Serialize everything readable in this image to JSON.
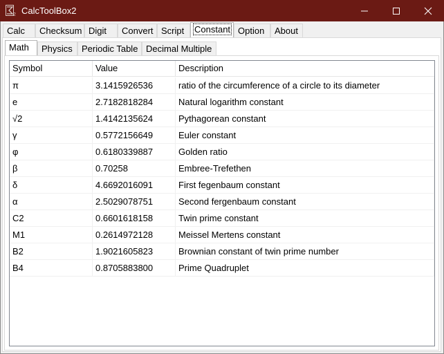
{
  "window": {
    "title": "CalcToolBox2",
    "icon": "calc-app-icon"
  },
  "window_controls": [
    "minimize-icon",
    "maximize-icon",
    "close-icon"
  ],
  "main_tabs": [
    {
      "label": "Calc"
    },
    {
      "label": "Checksum"
    },
    {
      "label": "Digit"
    },
    {
      "label": "Convert"
    },
    {
      "label": "Script"
    },
    {
      "label": "Constant",
      "selected": true
    },
    {
      "label": "Option"
    },
    {
      "label": "About"
    }
  ],
  "sub_tabs": [
    {
      "label": "Math",
      "selected": true
    },
    {
      "label": "Physics"
    },
    {
      "label": "Periodic Table"
    },
    {
      "label": "Decimal Multiple"
    }
  ],
  "table": {
    "columns": [
      "Symbol",
      "Value",
      "Description"
    ],
    "rows": [
      [
        "π",
        "3.1415926536",
        "ratio of the circumference of a circle to its diameter"
      ],
      [
        "e",
        "2.7182818284",
        "Natural logarithm constant"
      ],
      [
        "√2",
        "1.4142135624",
        "Pythagorean constant"
      ],
      [
        "γ",
        "0.5772156649",
        "Euler constant"
      ],
      [
        "φ",
        "0.6180339887",
        "Golden ratio"
      ],
      [
        "β",
        "0.70258",
        "Embree-Trefethen"
      ],
      [
        "δ",
        "4.6692016091",
        "First fegenbaum constant"
      ],
      [
        "α",
        "2.5029078751",
        "Second fergenbaum constant"
      ],
      [
        "C2",
        "0.6601618158",
        "Twin prime constant"
      ],
      [
        "M1",
        "0.2614972128",
        "Meissel Mertens constant"
      ],
      [
        "B2",
        "1.9021605823",
        "Brownian constant of twin prime number"
      ],
      [
        "B4",
        "0.8705883800",
        "Prime Quadruplet"
      ]
    ]
  },
  "colors": {
    "titlebar": "#6b1a14",
    "window_bg": "#f0f0f0"
  }
}
